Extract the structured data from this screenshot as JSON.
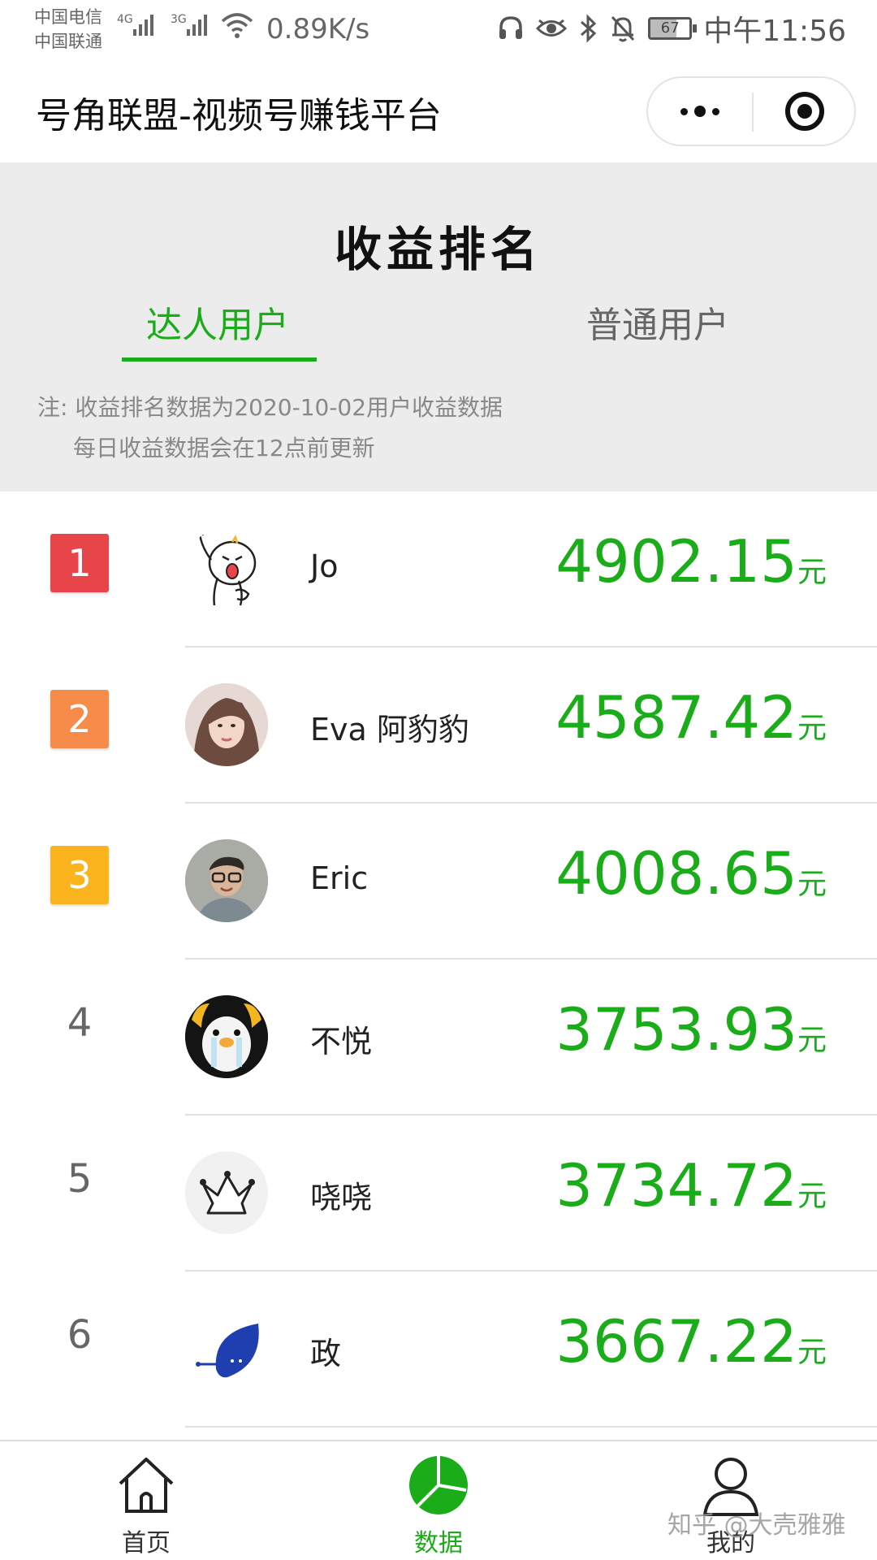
{
  "status_bar": {
    "carrier1": "中国电信",
    "carrier2": "中国联通",
    "signal1": "4G",
    "signal2": "3G",
    "net_speed": "0.89K/s",
    "icons": [
      "headset-icon",
      "eye-icon",
      "bluetooth-icon",
      "bell-off-icon"
    ],
    "battery": "67",
    "battery_level": 0.67,
    "time": "中午11:56"
  },
  "titlebar": {
    "title": "号角联盟-视频号赚钱平台",
    "more_icon": "more-dots-icon",
    "close_icon": "target-close-icon"
  },
  "header": {
    "title": "收益排名",
    "tabs": [
      {
        "label": "达人用户",
        "active": true
      },
      {
        "label": "普通用户",
        "active": false
      }
    ],
    "note_line1": "注: 收益排名数据为2020-10-02用户收益数据",
    "note_line2": "每日收益数据会在12点前更新"
  },
  "colors": {
    "accent": "#1aad19",
    "rank1": "#e8454a",
    "rank2": "#f78c4a",
    "rank3": "#fbb41d"
  },
  "ranking": [
    {
      "rank": "1",
      "name": "Jo",
      "amount": "4902.15",
      "unit": "元",
      "avatar": "cartoon-avatar"
    },
    {
      "rank": "2",
      "name": "Eva 阿豹豹",
      "amount": "4587.42",
      "unit": "元",
      "avatar": "photo-avatar"
    },
    {
      "rank": "3",
      "name": "Eric",
      "amount": "4008.65",
      "unit": "元",
      "avatar": "photo-avatar"
    },
    {
      "rank": "4",
      "name": "不悦",
      "amount": "3753.93",
      "unit": "元",
      "avatar": "penguin-avatar"
    },
    {
      "rank": "5",
      "name": "哓哓",
      "amount": "3734.72",
      "unit": "元",
      "avatar": "crown-avatar"
    },
    {
      "rank": "6",
      "name": "政",
      "amount": "3667.22",
      "unit": "元",
      "avatar": "leaf-avatar"
    }
  ],
  "bottom_nav": [
    {
      "label": "首页",
      "icon": "home-icon"
    },
    {
      "label": "数据",
      "icon": "pie-chart-icon",
      "active": true
    },
    {
      "label": "我的",
      "icon": "user-icon"
    }
  ],
  "watermark": "知乎 @大壳雅雅"
}
